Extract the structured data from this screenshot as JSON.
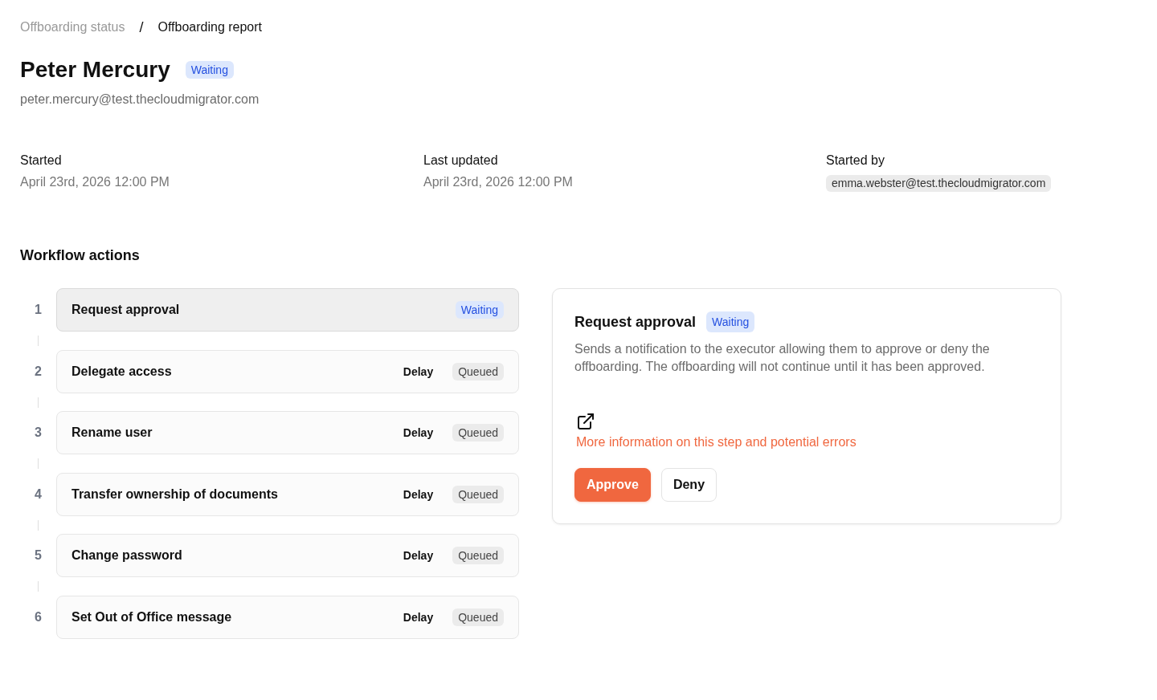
{
  "breadcrumb": {
    "items": [
      {
        "label": "Offboarding status",
        "current": false
      },
      {
        "label": "Offboarding report",
        "current": true
      }
    ],
    "separator": "/"
  },
  "user": {
    "name": "Peter Mercury",
    "status": {
      "label": "Waiting",
      "kind": "waiting"
    },
    "email": "peter.mercury@test.thecloudmigrator.com"
  },
  "details": [
    {
      "label": "Started",
      "value": "April 23rd, 2026 12:00 PM",
      "kind": "text"
    },
    {
      "label": "Last updated",
      "value": "April 23rd, 2026 12:00 PM",
      "kind": "text"
    },
    {
      "label": "Started by",
      "value": "emma.webster@test.thecloudmigrator.com",
      "kind": "tag"
    }
  ],
  "workflow": {
    "title": "Workflow actions",
    "steps": [
      {
        "number": "1",
        "name": "Request approval",
        "selected": true,
        "status": {
          "label": "Waiting",
          "kind": "waiting"
        }
      },
      {
        "number": "2",
        "name": "Delegate access",
        "selected": false,
        "delay": "Delay",
        "status": {
          "label": "Queued",
          "kind": "queued"
        }
      },
      {
        "number": "3",
        "name": "Rename user",
        "selected": false,
        "delay": "Delay",
        "status": {
          "label": "Queued",
          "kind": "queued"
        }
      },
      {
        "number": "4",
        "name": "Transfer ownership of documents",
        "selected": false,
        "delay": "Delay",
        "status": {
          "label": "Queued",
          "kind": "queued"
        }
      },
      {
        "number": "5",
        "name": "Change password",
        "selected": false,
        "delay": "Delay",
        "status": {
          "label": "Queued",
          "kind": "queued"
        }
      },
      {
        "number": "6",
        "name": "Set Out of Office message",
        "selected": false,
        "delay": "Delay",
        "status": {
          "label": "Queued",
          "kind": "queued"
        }
      }
    ]
  },
  "detail_panel": {
    "title": "Request approval",
    "status": {
      "label": "Waiting",
      "kind": "waiting"
    },
    "description": "Sends a notification to the executor allowing them to approve or deny the offboarding. The offboarding will not continue until it has been approved.",
    "link": "More information on this step and potential errors",
    "buttons": [
      {
        "label": "Approve",
        "kind": "primary"
      },
      {
        "label": "Deny",
        "kind": "secondary"
      }
    ]
  }
}
